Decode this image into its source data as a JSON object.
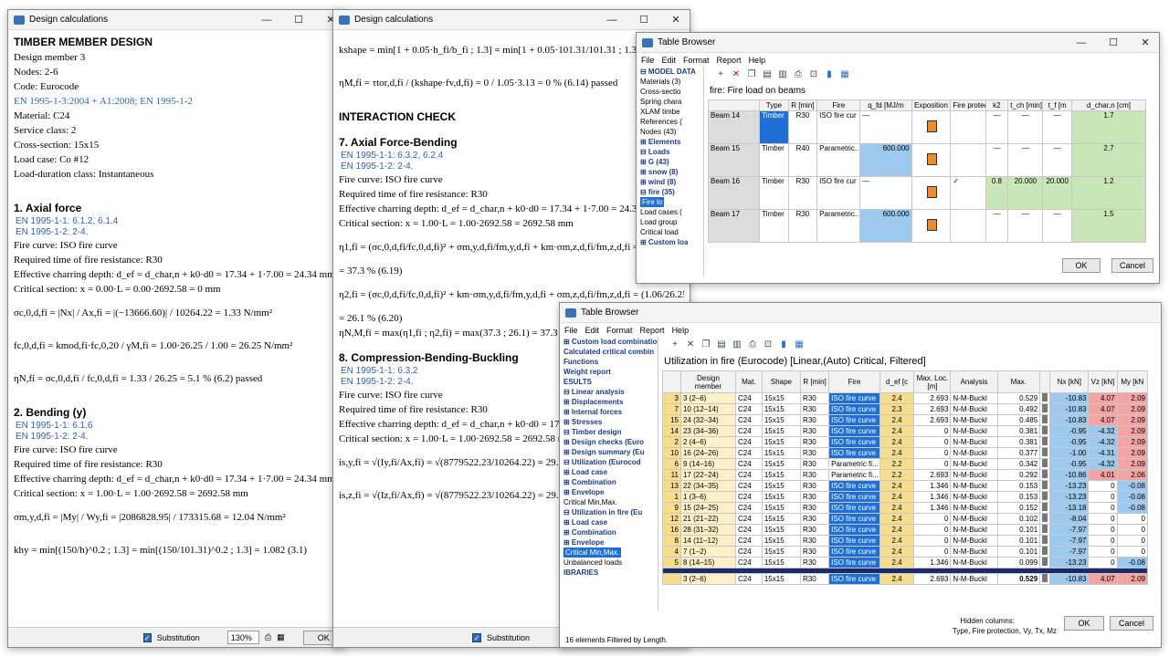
{
  "calc1": {
    "title": "Design calculations",
    "substitution": "Substitution",
    "zoom": "130%",
    "ok": "OK",
    "lines": [
      {
        "t": "h",
        "v": "TIMBER MEMBER DESIGN"
      },
      {
        "t": "l",
        "v": "Design member 3"
      },
      {
        "t": "l",
        "v": "Nodes: 2-6"
      },
      {
        "t": "l",
        "v": "Code: Eurocode"
      },
      {
        "t": "lb",
        "v": "EN 1995-1-3:2004 + A1:2008; EN 1995-1-2"
      },
      {
        "t": "l",
        "v": "Material: C24"
      },
      {
        "t": "l",
        "v": "Service class: 2"
      },
      {
        "t": "l",
        "v": "Cross-section: 15x15"
      },
      {
        "t": "l",
        "v": "Load case: Co #12"
      },
      {
        "t": "l",
        "v": "Load-duration class: Instantaneous"
      },
      {
        "t": "sp"
      },
      {
        "t": "sp"
      },
      {
        "t": "h",
        "v": "1. Axial force"
      },
      {
        "t": "r",
        "v": "EN 1995-1-1: 6.1.2, 6.1.4"
      },
      {
        "t": "r",
        "v": "EN 1995-1-2: 2-4."
      },
      {
        "t": "l",
        "v": "Fire curve: ISO fire curve"
      },
      {
        "t": "l",
        "v": "Required time of fire resistance: R30"
      },
      {
        "t": "l",
        "v": "Effective charring depth: d_ef = d_char,n + k0·d0 = 17.34 + 1·7.00 = 24.34 mm"
      },
      {
        "t": "l",
        "v": "Critical section:  x = 0.00·L = 0.00·2692.58 = 0 mm"
      },
      {
        "t": "eq",
        "v": "σc,0,d,fi = |Nx| / Ax,fi = |(−13666.60)| / 10264.22 = 1.33 N/mm²"
      },
      {
        "t": "eq",
        "v": "fc,0,d,fi = kmod,fi·fc,0,20 / γM,fi = 1.00·26.25 / 1.00 = 26.25 N/mm²"
      },
      {
        "t": "eq",
        "v": "ηN,fi = σc,0,d,fi / fc,0,d,fi = 1.33 / 26.25 = 5.1 %   (6.2)          passed"
      },
      {
        "t": "sp"
      },
      {
        "t": "h",
        "v": "2. Bending (y)"
      },
      {
        "t": "r",
        "v": "EN 1995-1-1: 6.1.6"
      },
      {
        "t": "r",
        "v": "EN 1995-1-2: 2-4."
      },
      {
        "t": "l",
        "v": "Fire curve: ISO fire curve"
      },
      {
        "t": "l",
        "v": "Required time of fire resistance: R30"
      },
      {
        "t": "l",
        "v": "Effective charring depth: d_ef = d_char,n + k0·d0 = 17.34 + 1·7.00 = 24.34 mm"
      },
      {
        "t": "l",
        "v": "Critical section:  x = 1.00·L = 1.00·2692.58 = 2692.58 mm"
      },
      {
        "t": "eq",
        "v": "σm,y,d,fi = |My| / Wy,fi = |2086828.95| / 173315.68 = 12.04 N/mm²"
      },
      {
        "t": "eq",
        "v": "khy = min[(150/h)^0.2 ; 1.3] = min[(150/101.31)^0.2 ; 1.3] = 1.082   (3.1)"
      }
    ]
  },
  "calc2": {
    "title": "Design calculations",
    "substitution": "Substitution",
    "lines": [
      {
        "t": "eq",
        "v": "kshape = min[1 + 0.05·h_fi/b_fi ; 1.3] = min[1 + 0.05·101.31/101.31 ; 1.3] = 1.05   (6."
      },
      {
        "t": "eq",
        "v": "ηM,fi = τtor,d,fi / (kshape·fv,d,fi) = 0 / 1.05·3.13 = 0 %   (6.14)          passed"
      },
      {
        "t": "sp"
      },
      {
        "t": "h",
        "v": "INTERACTION CHECK"
      },
      {
        "t": "sp"
      },
      {
        "t": "h",
        "v": "7. Axial Force-Bending"
      },
      {
        "t": "r",
        "v": "EN 1995-1-1: 6.3.2, 6.2.4"
      },
      {
        "t": "r",
        "v": "EN 1995-1-2: 2-4."
      },
      {
        "t": "l",
        "v": "Fire curve: ISO fire curve"
      },
      {
        "t": "l",
        "v": "Required time of fire resistance: R30"
      },
      {
        "t": "l",
        "v": "Effective charring depth: d_ef = d_char,n + k0·d0 = 17.34 + 1·7.00 = 24.34 mm"
      },
      {
        "t": "l",
        "v": "Critical section:  x = 1.00·L = 1.00·2692.58 = 2692.58 mm"
      },
      {
        "t": "eq",
        "v": "η1,fi = (σc,0,d,fi/fc,0,d,fi)² + σm,y,d,fi/fm,y,d,fi + km·σm,z,d,fi/fm,z,d,fi = (1.06/26.25)² + 12.04/32.45 + 0.7·"
      },
      {
        "t": "l",
        "v": "= 37.3 %   (6.19)"
      },
      {
        "t": "eq",
        "v": "η2,fi = (σc,0,d,fi/fc,0,d,fi)² + km·σm,y,d,fi/fm,y,d,fi + σm,z,d,fi/fm,z,d,fi = (1.06/26.25)²"
      },
      {
        "t": "l",
        "v": "= 26.1 %   (6.20)"
      },
      {
        "t": "l",
        "v": "ηN,M,fi = max(η1,fi ; η2,fi) = max(37.3 ; 26.1) = 37.3 %"
      },
      {
        "t": "sp"
      },
      {
        "t": "h",
        "v": "8. Compression-Bending-Buckling"
      },
      {
        "t": "r",
        "v": "EN 1995-1-1: 6.3.2"
      },
      {
        "t": "r",
        "v": "EN 1995-1-2: 2-4."
      },
      {
        "t": "l",
        "v": "Fire curve: ISO fire curve"
      },
      {
        "t": "l",
        "v": "Required time of fire resistance: R30"
      },
      {
        "t": "l",
        "v": "Effective charring depth: d_ef = d_char,n + k0·d0 = 17.34 + 1·7.00 = 24.34"
      },
      {
        "t": "l",
        "v": "Critical section:  x = 1.00·L = 1.00·2692.58 = 2692.58 mm"
      },
      {
        "t": "eq",
        "v": "is,y,fi = √(Iy,fi/Ax,fi) = √(8779522.23/10264.22) = 29.25 mm"
      },
      {
        "t": "eq",
        "v": "is,z,fi = √(Iz,fi/Ax,fi) = √(8779522.23/10264.22) = 29.25 mm"
      }
    ]
  },
  "tb1": {
    "title": "Table Browser",
    "menu": [
      "File",
      "Edit",
      "Format",
      "Report",
      "Help"
    ],
    "caption": "fire: Fire load on beams",
    "ok": "OK",
    "cancel": "Cancel",
    "tree": [
      {
        "v": "⊟ MODEL DATA",
        "c": "bb"
      },
      {
        "v": "   Materials (3)"
      },
      {
        "v": "   Cross-sectio"
      },
      {
        "v": "   Spring chara"
      },
      {
        "v": "   XLAM timbe"
      },
      {
        "v": "   References ("
      },
      {
        "v": "   Nodes (43)"
      },
      {
        "v": "⊞ Elements",
        "c": "bb"
      },
      {
        "v": "⊟ Loads",
        "c": "bb"
      },
      {
        "v": "   ⊞ G (43)",
        "c": "bb"
      },
      {
        "v": "   ⊞ snow (8)",
        "c": "bb"
      },
      {
        "v": "   ⊞ wind (8)",
        "c": "bb"
      },
      {
        "v": "   ⊟ fire (35)",
        "c": "bb"
      },
      {
        "v": "      Fire lo",
        "c": "hl"
      },
      {
        "v": "   Load cases ("
      },
      {
        "v": "   Load group"
      },
      {
        "v": "   Critical load"
      },
      {
        "v": "⊞ Custom loa",
        "c": "bb"
      }
    ],
    "headers": [
      "",
      "Type",
      "R [min]",
      "Fire",
      "q_fd [MJ/m",
      "Exposition",
      "Fire protection",
      "k2",
      "t_ch [min]",
      "t_f [m",
      "d_char,n [cm]"
    ],
    "rows": [
      [
        "Beam 14",
        "Timber",
        "R30",
        "ISO fire cur",
        "—",
        "",
        "",
        "—",
        "—",
        "—",
        "1.7"
      ],
      [
        "Beam 15",
        "Timber",
        "R40",
        "Parametric...",
        "600.000",
        "",
        "",
        "—",
        "—",
        "—",
        "2.7"
      ],
      [
        "Beam 16",
        "Timber",
        "R30",
        "ISO fire cur",
        "—",
        "",
        "✓",
        "0.8",
        "20.000",
        "20.000",
        "1.2"
      ],
      [
        "Beam 17",
        "Timber",
        "R30",
        "Parametric...",
        "600.000",
        "",
        "",
        "—",
        "—",
        "—",
        "1.5"
      ]
    ]
  },
  "tb2": {
    "title": "Table Browser",
    "menu": [
      "File",
      "Edit",
      "Format",
      "Report",
      "Help"
    ],
    "caption": "Utilization in fire (Eurocode) [Linear,(Auto) Critical, Filtered]",
    "status": "16 elements Filtered by Length.",
    "hidden_label": "Hidden columns:",
    "hidden_cols": "Type, Fire protection, Vy, Tx, Mz",
    "ok": "OK",
    "cancel": "Cancel",
    "tree": [
      {
        "v": "⊞ Custom load combination",
        "c": "bb"
      },
      {
        "v": "  Calculated critical combin",
        "c": "bb"
      },
      {
        "v": "  Functions",
        "c": "bb"
      },
      {
        "v": "  Weight report",
        "c": "bb"
      },
      {
        "v": "ESULTS",
        "c": "bb"
      },
      {
        "v": "⊟ Linear analysis",
        "c": "bb"
      },
      {
        "v": "  ⊞ Displacements",
        "c": "bb"
      },
      {
        "v": "  ⊞ Internal forces",
        "c": "bb"
      },
      {
        "v": "  ⊞ Stresses",
        "c": "bb"
      },
      {
        "v": "  ⊟ Timber design",
        "c": "bb"
      },
      {
        "v": "    ⊞ Design checks (Euro",
        "c": "bb"
      },
      {
        "v": "    ⊞ Design summary (Eu",
        "c": "bb"
      },
      {
        "v": "    ⊟ Utilization (Eurocod",
        "c": "bb"
      },
      {
        "v": "       ⊞ Load case",
        "c": "bb"
      },
      {
        "v": "       ⊞ Combination",
        "c": "bb"
      },
      {
        "v": "       ⊞ Envelope",
        "c": "bb"
      },
      {
        "v": "         Critical Min,Max."
      },
      {
        "v": "    ⊟ Utilization in fire (Eu",
        "c": "bb"
      },
      {
        "v": "       ⊞ Load case",
        "c": "bb"
      },
      {
        "v": "       ⊞ Combination",
        "c": "bb"
      },
      {
        "v": "       ⊞ Envelope",
        "c": "bb"
      },
      {
        "v": "         Critical Min,Max.",
        "c": "hl"
      },
      {
        "v": "  Unbalanced loads"
      },
      {
        "v": "IBRARIES",
        "c": "bb"
      }
    ],
    "headers": [
      "",
      "Design member",
      "Mat.",
      "Shape",
      "R [min]",
      "Fire",
      "d_ef [c",
      "Max. Loc. [m]",
      "Analysis",
      "Max.",
      "",
      "Nx [kN]",
      "Vz [kN]",
      "My [kN"
    ],
    "rows": [
      [
        "3",
        "3 (2–6)",
        "C24",
        "15x15",
        "R30",
        "ISO fire curve",
        "2.4",
        "2.693",
        "N-M-Buckl",
        "0.529",
        "",
        "-10.83",
        "4.07",
        "2.09"
      ],
      [
        "7",
        "10 (12–14)",
        "C24",
        "15x15",
        "R30",
        "ISO fire curve",
        "2.3",
        "2.693",
        "N-M-Buckl",
        "0.492",
        "",
        "-10.83",
        "4.07",
        "2.09"
      ],
      [
        "15",
        "24 (32–34)",
        "C24",
        "15x15",
        "R30",
        "ISO fire curve",
        "2.4",
        "2.693",
        "N-M-Buckl",
        "0.485",
        "",
        "-10.83",
        "4.07",
        "2.09"
      ],
      [
        "14",
        "23 (34–36)",
        "C24",
        "15x15",
        "R30",
        "ISO fire curve",
        "2.4",
        "0",
        "N-M-Buckl",
        "0.381",
        "",
        "-0.95",
        "-4.32",
        "2.09"
      ],
      [
        "2",
        "2 (4–6)",
        "C24",
        "15x15",
        "R30",
        "ISO fire curve",
        "2.4",
        "0",
        "N-M-Buckl",
        "0.381",
        "",
        "-0.95",
        "-4.32",
        "2.09"
      ],
      [
        "10",
        "16 (24–26)",
        "C24",
        "15x15",
        "R30",
        "ISO fire curve",
        "2.4",
        "0",
        "N-M-Buckl",
        "0.377",
        "",
        "-1.00",
        "-4.31",
        "2.09"
      ],
      [
        "6",
        "9 (14–16)",
        "C24",
        "15x15",
        "R30",
        "Parametric fi...",
        "2.2",
        "0",
        "N-M-Buckl",
        "0.342",
        "",
        "-0.95",
        "-4.32",
        "2.09"
      ],
      [
        "11",
        "17 (22–24)",
        "C24",
        "15x15",
        "R30",
        "Parametric fi...",
        "2.2",
        "2.693",
        "N-M-Buckl",
        "0.292",
        "",
        "-10.86",
        "4.01",
        "2.06"
      ],
      [
        "13",
        "22 (34–35)",
        "C24",
        "15x15",
        "R30",
        "ISO fire curve",
        "2.4",
        "1.346",
        "N-M-Buckl",
        "0.153",
        "",
        "-13.23",
        "0",
        "-0.08"
      ],
      [
        "1",
        "1 (3–6)",
        "C24",
        "15x15",
        "R30",
        "ISO fire curve",
        "2.4",
        "1.346",
        "N-M-Buckl",
        "0.153",
        "",
        "-13.23",
        "0",
        "-0.08"
      ],
      [
        "9",
        "15 (24–25)",
        "C24",
        "15x15",
        "R30",
        "ISO fire curve",
        "2.4",
        "1.346",
        "N-M-Buckl",
        "0.152",
        "",
        "-13.18",
        "0",
        "-0.08"
      ],
      [
        "12",
        "21 (21–22)",
        "C24",
        "15x15",
        "R30",
        "ISO fire curve",
        "2.4",
        "0",
        "N-M-Buckl",
        "0.102",
        "",
        "-8.04",
        "0",
        "0"
      ],
      [
        "16",
        "28 (31–32)",
        "C24",
        "15x15",
        "R30",
        "ISO fire curve",
        "2.4",
        "0",
        "N-M-Buckl",
        "0.101",
        "",
        "-7.97",
        "0",
        "0"
      ],
      [
        "8",
        "14 (11–12)",
        "C24",
        "15x15",
        "R30",
        "ISO fire curve",
        "2.4",
        "0",
        "N-M-Buckl",
        "0.101",
        "",
        "-7.97",
        "0",
        "0"
      ],
      [
        "4",
        "7 (1–2)",
        "C24",
        "15x15",
        "R30",
        "ISO fire curve",
        "2.4",
        "0",
        "N-M-Buckl",
        "0.101",
        "",
        "-7.97",
        "0",
        "0"
      ],
      [
        "5",
        "8 (14–15)",
        "C24",
        "15x15",
        "R30",
        "ISO fire curve",
        "2.4",
        "1.346",
        "N-M-Buckl",
        "0.099",
        "",
        "-13.23",
        "0",
        "-0.08"
      ]
    ],
    "summary": [
      "",
      "3 (2–6)",
      "C24",
      "15x15",
      "R30",
      "ISO fire curve",
      "2.4",
      "2.693",
      "N-M-Buckl",
      "0.529",
      "",
      "-10.83",
      "4.07",
      "2.09"
    ]
  }
}
